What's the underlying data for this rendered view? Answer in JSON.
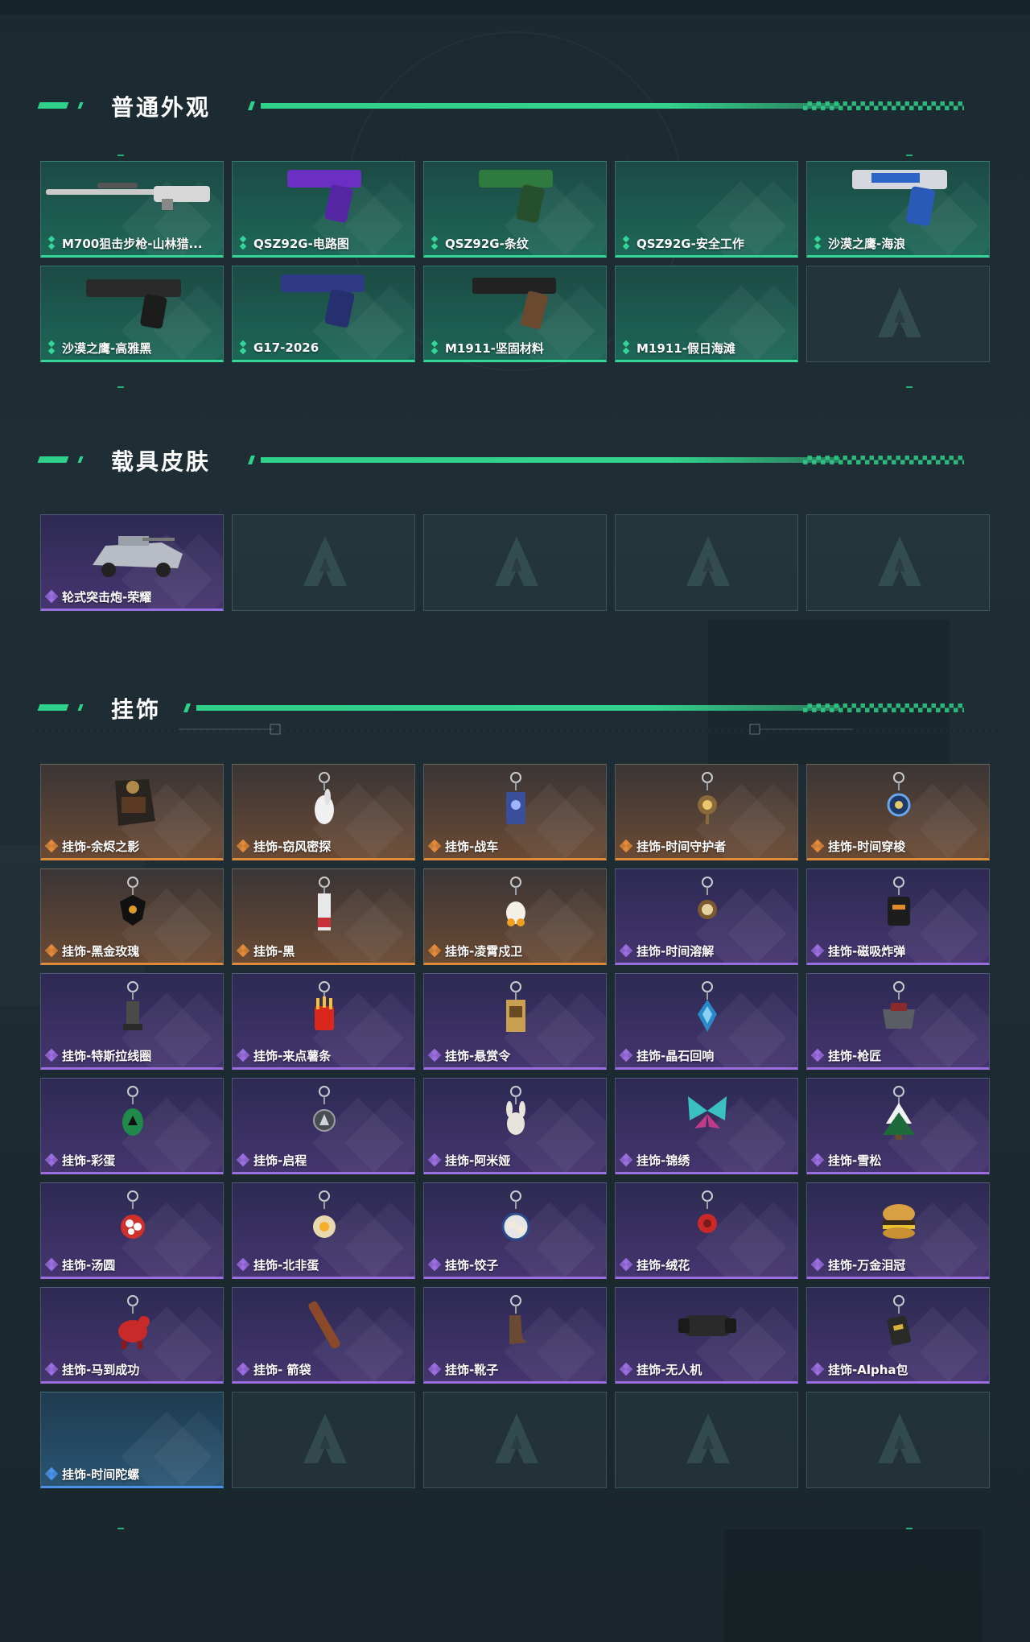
{
  "sections": {
    "normal": {
      "title": "普通外观",
      "items": [
        {
          "label": "M700狙击步枪-山林猎...",
          "rarity": "green",
          "icon": "sniper-rifle-icon"
        },
        {
          "label": "QSZ92G-电路图",
          "rarity": "green",
          "icon": "pistol-purple-icon"
        },
        {
          "label": "QSZ92G-条纹",
          "rarity": "green",
          "icon": "pistol-green-icon"
        },
        {
          "label": "QSZ92G-安全工作",
          "rarity": "green",
          "icon": ""
        },
        {
          "label": "沙漠之鹰-海浪",
          "rarity": "green",
          "icon": "desert-eagle-wave-icon"
        },
        {
          "label": "沙漠之鹰-高雅黑",
          "rarity": "green",
          "icon": "desert-eagle-black-icon"
        },
        {
          "label": "G17-2026",
          "rarity": "green",
          "icon": "g17-pistol-icon"
        },
        {
          "label": "M1911-坚固材料",
          "rarity": "green",
          "icon": "m1911-pistol-icon"
        },
        {
          "label": "M1911-假日海滩",
          "rarity": "green",
          "icon": ""
        },
        {
          "label": "",
          "rarity": "empty",
          "icon": "empty-slot-logo-icon"
        }
      ]
    },
    "vehicle": {
      "title": "载具皮肤",
      "items": [
        {
          "label": "轮式突击炮-荣耀",
          "rarity": "purple",
          "icon": "armored-vehicle-icon"
        },
        {
          "label": "",
          "rarity": "empty",
          "icon": "empty-slot-logo-icon"
        },
        {
          "label": "",
          "rarity": "empty",
          "icon": "empty-slot-logo-icon"
        },
        {
          "label": "",
          "rarity": "empty",
          "icon": "empty-slot-logo-icon"
        },
        {
          "label": "",
          "rarity": "empty",
          "icon": "empty-slot-logo-icon"
        }
      ]
    },
    "charms": {
      "title": "挂饰",
      "items": [
        {
          "label": "挂饰-余烬之影",
          "rarity": "orange",
          "icon": "charm-ember-figure-icon"
        },
        {
          "label": "挂饰-窃风密探",
          "rarity": "orange",
          "icon": "charm-rabbit-icon"
        },
        {
          "label": "挂饰-战车",
          "rarity": "orange",
          "icon": "charm-tarot-card-icon"
        },
        {
          "label": "挂饰-时间守护者",
          "rarity": "orange",
          "icon": "charm-clock-key-icon"
        },
        {
          "label": "挂饰-时间穿梭",
          "rarity": "orange",
          "icon": "charm-orb-icon"
        },
        {
          "label": "挂饰-黑金玫瑰",
          "rarity": "orange",
          "icon": "charm-black-rose-icon"
        },
        {
          "label": "挂饰-黑",
          "rarity": "orange",
          "icon": "charm-tag-icon"
        },
        {
          "label": "挂饰-凌霄戍卫",
          "rarity": "orange",
          "icon": "charm-duck-icon"
        },
        {
          "label": "挂饰-时间溶解",
          "rarity": "purple",
          "icon": "charm-clock-icon"
        },
        {
          "label": "挂饰-磁吸炸弹",
          "rarity": "purple",
          "icon": "charm-bomb-icon"
        },
        {
          "label": "挂饰-特斯拉线圈",
          "rarity": "purple",
          "icon": "charm-tesla-coil-icon"
        },
        {
          "label": "挂饰-来点薯条",
          "rarity": "purple",
          "icon": "charm-fries-icon"
        },
        {
          "label": "挂饰-悬赏令",
          "rarity": "purple",
          "icon": "charm-wanted-poster-icon"
        },
        {
          "label": "挂饰-晶石回响",
          "rarity": "purple",
          "icon": "charm-crystal-icon"
        },
        {
          "label": "挂饰-枪匠",
          "rarity": "purple",
          "icon": "charm-gunsmith-icon"
        },
        {
          "label": "挂饰-彩蛋",
          "rarity": "purple",
          "icon": "charm-easter-egg-icon"
        },
        {
          "label": "挂饰-启程",
          "rarity": "purple",
          "icon": "charm-emblem-icon"
        },
        {
          "label": "挂饰-阿米娅",
          "rarity": "purple",
          "icon": "charm-bunny-icon"
        },
        {
          "label": "挂饰-锦绣",
          "rarity": "purple",
          "icon": "charm-butterfly-icon"
        },
        {
          "label": "挂饰-雪松",
          "rarity": "purple",
          "icon": "charm-pine-tree-icon"
        },
        {
          "label": "挂饰-汤圆",
          "rarity": "purple",
          "icon": "charm-dumpling-bowl-icon"
        },
        {
          "label": "挂饰-北非蛋",
          "rarity": "purple",
          "icon": "charm-egg-dish-icon"
        },
        {
          "label": "挂饰-饺子",
          "rarity": "purple",
          "icon": "charm-dumpling-plate-icon"
        },
        {
          "label": "挂饰-绒花",
          "rarity": "purple",
          "icon": "charm-velvet-flower-icon"
        },
        {
          "label": "挂饰-万金泪冠",
          "rarity": "purple",
          "icon": "charm-burger-icon"
        },
        {
          "label": "挂饰-马到成功",
          "rarity": "purple",
          "icon": "charm-red-horse-icon"
        },
        {
          "label": "挂饰- 箭袋",
          "rarity": "purple",
          "icon": "charm-quiver-icon"
        },
        {
          "label": "挂饰-靴子",
          "rarity": "purple",
          "icon": "charm-boot-icon"
        },
        {
          "label": "挂饰-无人机",
          "rarity": "purple",
          "icon": "charm-drone-icon"
        },
        {
          "label": "挂饰-Alpha包",
          "rarity": "purple",
          "icon": "charm-alpha-bag-icon"
        },
        {
          "label": "挂饰-时间陀螺",
          "rarity": "blue",
          "icon": ""
        },
        {
          "label": "",
          "rarity": "empty",
          "icon": "empty-slot-logo-icon"
        },
        {
          "label": "",
          "rarity": "empty",
          "icon": "empty-slot-logo-icon"
        },
        {
          "label": "",
          "rarity": "empty",
          "icon": "empty-slot-logo-icon"
        },
        {
          "label": "",
          "rarity": "empty",
          "icon": "empty-slot-logo-icon"
        }
      ]
    }
  },
  "colors": {
    "accent": "#2fd08a",
    "green": "#34d69a",
    "purple": "#9b6ee0",
    "orange": "#e08a3a",
    "blue": "#4a92e8"
  }
}
